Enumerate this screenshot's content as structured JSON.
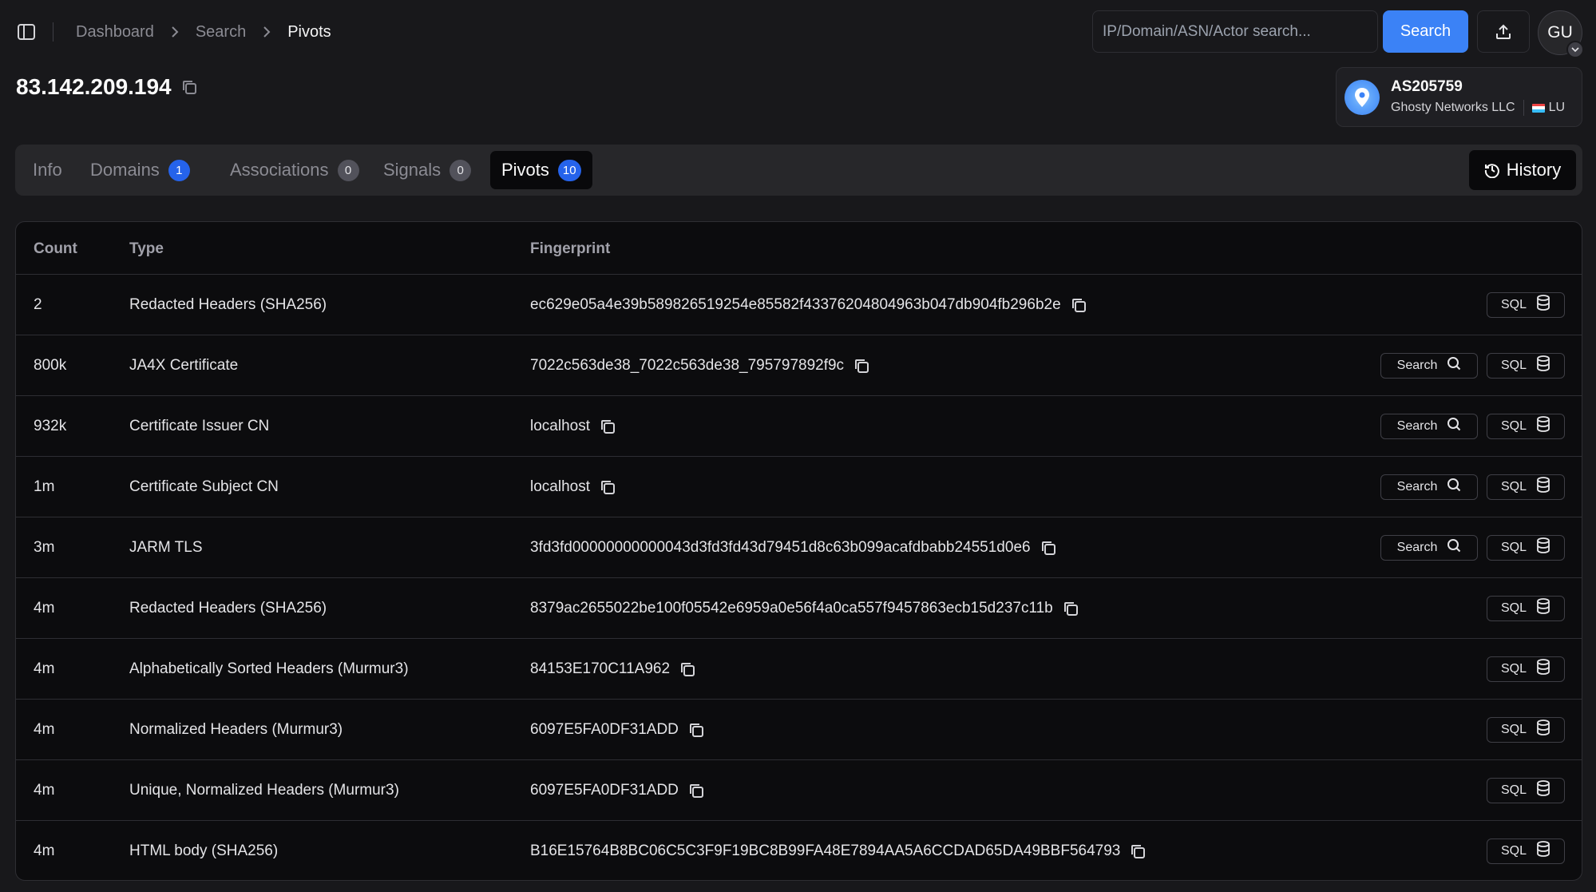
{
  "breadcrumb": [
    "Dashboard",
    "Search",
    "Pivots"
  ],
  "search": {
    "placeholder": "IP/Domain/ASN/Actor search...",
    "button_label": "Search"
  },
  "user": {
    "initials": "GU"
  },
  "page": {
    "title": "83.142.209.194"
  },
  "asn": {
    "number": "AS205759",
    "org": "Ghosty Networks LLC",
    "country": "LU"
  },
  "tabs": [
    {
      "label": "Info",
      "count": null
    },
    {
      "label": "Domains",
      "count": "1"
    },
    {
      "label": "Associations",
      "count": "0"
    },
    {
      "label": "Signals",
      "count": "0"
    },
    {
      "label": "Pivots",
      "count": "10"
    }
  ],
  "history_label": "History",
  "table": {
    "headers": {
      "count": "Count",
      "type": "Type",
      "fingerprint": "Fingerprint"
    },
    "action_labels": {
      "search": "Search",
      "sql": "SQL"
    },
    "rows": [
      {
        "count": "2",
        "type": "Redacted Headers (SHA256)",
        "fingerprint": "ec629e05a4e39b589826519254e85582f43376204804963b047db904fb296b2e",
        "search": false
      },
      {
        "count": "800k",
        "type": "JA4X Certificate",
        "fingerprint": "7022c563de38_7022c563de38_795797892f9c",
        "search": true
      },
      {
        "count": "932k",
        "type": "Certificate Issuer CN",
        "fingerprint": "localhost",
        "search": true
      },
      {
        "count": "1m",
        "type": "Certificate Subject CN",
        "fingerprint": "localhost",
        "search": true
      },
      {
        "count": "3m",
        "type": "JARM TLS",
        "fingerprint": "3fd3fd00000000000043d3fd3fd43d79451d8c63b099acafdbabb24551d0e6",
        "search": true
      },
      {
        "count": "4m",
        "type": "Redacted Headers (SHA256)",
        "fingerprint": "8379ac2655022be100f05542e6959a0e56f4a0ca557f9457863ecb15d237c11b",
        "search": false
      },
      {
        "count": "4m",
        "type": "Alphabetically Sorted Headers (Murmur3)",
        "fingerprint": "84153E170C11A962",
        "search": false
      },
      {
        "count": "4m",
        "type": "Normalized Headers (Murmur3)",
        "fingerprint": "6097E5FA0DF31ADD",
        "search": false
      },
      {
        "count": "4m",
        "type": "Unique, Normalized Headers (Murmur3)",
        "fingerprint": "6097E5FA0DF31ADD",
        "search": false
      },
      {
        "count": "4m",
        "type": "HTML body (SHA256)",
        "fingerprint": "B16E15764B8BC06C5C3F9F19BC8B99FA48E7894AA5A6CCDAD65DA49BBF564793",
        "search": false
      }
    ]
  },
  "colors": {
    "accent": "#3b82f6",
    "background": "#18181b",
    "table_background": "#0c0c0e",
    "badge_blue": "#2563eb"
  },
  "icons": [
    "sidebar-toggle-icon",
    "chevron-right-icon",
    "upload-icon",
    "chevron-down-icon",
    "copy-icon",
    "location-pin-icon",
    "history-icon",
    "search-icon",
    "database-icon"
  ]
}
